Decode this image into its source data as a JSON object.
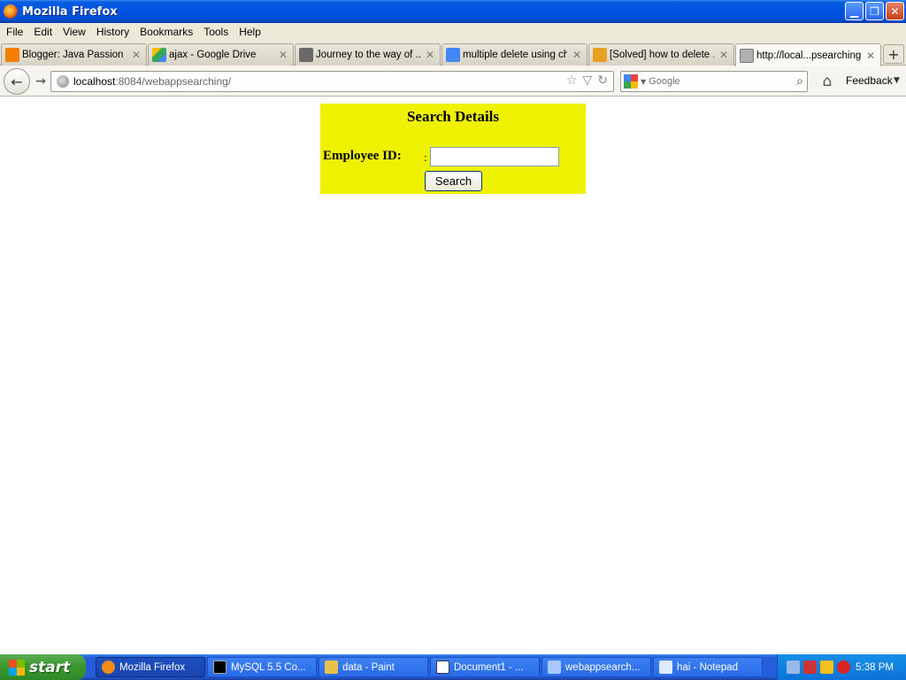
{
  "window": {
    "title": "Mozilla Firefox"
  },
  "menu": [
    "File",
    "Edit",
    "View",
    "History",
    "Bookmarks",
    "Tools",
    "Help"
  ],
  "tabs": [
    {
      "label": "Blogger: Java Passion -...",
      "icon": "blogger-icon",
      "color": "#f57d00"
    },
    {
      "label": "ajax - Google Drive",
      "icon": "google-drive-icon",
      "color": "#34a853"
    },
    {
      "label": "Journey to the way of ...",
      "icon": "java-icon",
      "color": "#5a5a5a"
    },
    {
      "label": "multiple delete using ch...",
      "icon": "google-icon",
      "color": "#4285f4"
    },
    {
      "label": "[Solved] how to delete ...",
      "icon": "codeproject-icon",
      "color": "#e8a020"
    },
    {
      "label": "http://local...psearching/",
      "icon": "page-icon",
      "color": "#8a8a8a",
      "active": true
    }
  ],
  "nav": {
    "url_host": "localhost",
    "url_rest": ":8084/webappsearching/",
    "search_placeholder": "Google",
    "feedback": "Feedback"
  },
  "page": {
    "title": "Search Details",
    "employee_label": "Employee ID:",
    "colon": ":",
    "employee_value": "",
    "search_button": "Search",
    "panel_color": "#eef200"
  },
  "taskbar": {
    "start_label": "start",
    "tasks": [
      {
        "label": "Mozilla Firefox",
        "icon": "firefox-icon",
        "color": "#f58a18",
        "active": true
      },
      {
        "label": "MySQL 5.5 Co...",
        "icon": "console-icon",
        "color": "#000000"
      },
      {
        "label": "data - Paint",
        "icon": "paint-icon",
        "color": "#e8c04a"
      },
      {
        "label": "Document1 - ...",
        "icon": "word-icon",
        "color": "#ffffff"
      },
      {
        "label": "webappsearch...",
        "icon": "netbeans-icon",
        "color": "#a8c8ff"
      },
      {
        "label": "hai - Notepad",
        "icon": "notepad-icon",
        "color": "#dfe9ff"
      }
    ],
    "clock": "5:38 PM"
  }
}
